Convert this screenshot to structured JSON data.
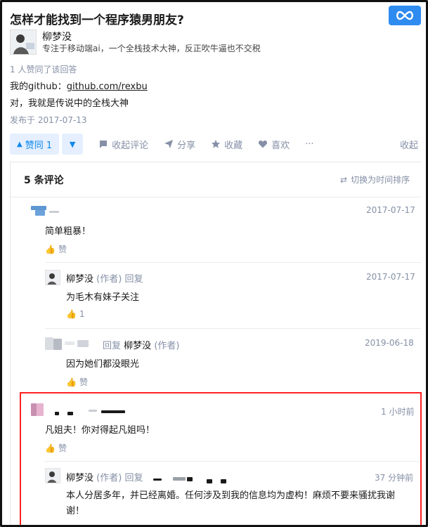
{
  "question": {
    "title": "怎样才能找到一个程序猿男朋友?"
  },
  "answer": {
    "author": "柳梦没",
    "bio": "专注于移动端ai，一个全栈技术大神，反正吹牛逼也不交税",
    "likes_line": "1 人赞同了该回答",
    "content_prefix": "我的github：",
    "content_link": "github.com/rexbu",
    "content_line2": "对，我就是传说中的全栈大神",
    "published": "发布于 2017-07-13"
  },
  "actions": {
    "vote_label": "赞同 1",
    "collapse_comments": "收起评论",
    "share": "分享",
    "favorite": "收藏",
    "like": "喜欢",
    "more": "···",
    "collapse": "收起"
  },
  "comments": {
    "count_label": "5 条评论",
    "sort_label": "切换为时间排序",
    "items": [
      {
        "time": "2017-07-17",
        "text": "简单粗暴！",
        "like": "赞"
      },
      {
        "author": "柳梦没",
        "role": "(作者)",
        "reply": "回复",
        "time": "2017-07-17",
        "text": "为毛木有妹子关注",
        "like": "1"
      },
      {
        "reply": "回复",
        "reply_to": "柳梦没",
        "role": "(作者)",
        "time": "2019-06-18",
        "text": "因为她们都没眼光",
        "like": "赞"
      },
      {
        "time": "1 小时前",
        "text": "凡姐夫！你对得起凡姐吗！",
        "like": "赞"
      },
      {
        "author": "柳梦没",
        "role": "(作者)",
        "reply": "回复",
        "time": "37 分钟前",
        "text_line1": "本人分居多年，并已经离婚。任何涉及到我的信息均为虚构！麻烦不要来骚扰我谢",
        "text_line2": "谢！"
      }
    ]
  },
  "colors": {
    "accent": "#0f88eb",
    "vote_bg": "#e5efff",
    "highlight_border": "#ff2222",
    "muted": "#8590a6"
  },
  "icons": [
    "infinity-logo-icon",
    "triangle-up-icon",
    "triangle-down-icon",
    "comment-icon",
    "share-icon",
    "star-icon",
    "heart-icon",
    "more-icon",
    "switch-icon",
    "thumbs-up-icon"
  ]
}
